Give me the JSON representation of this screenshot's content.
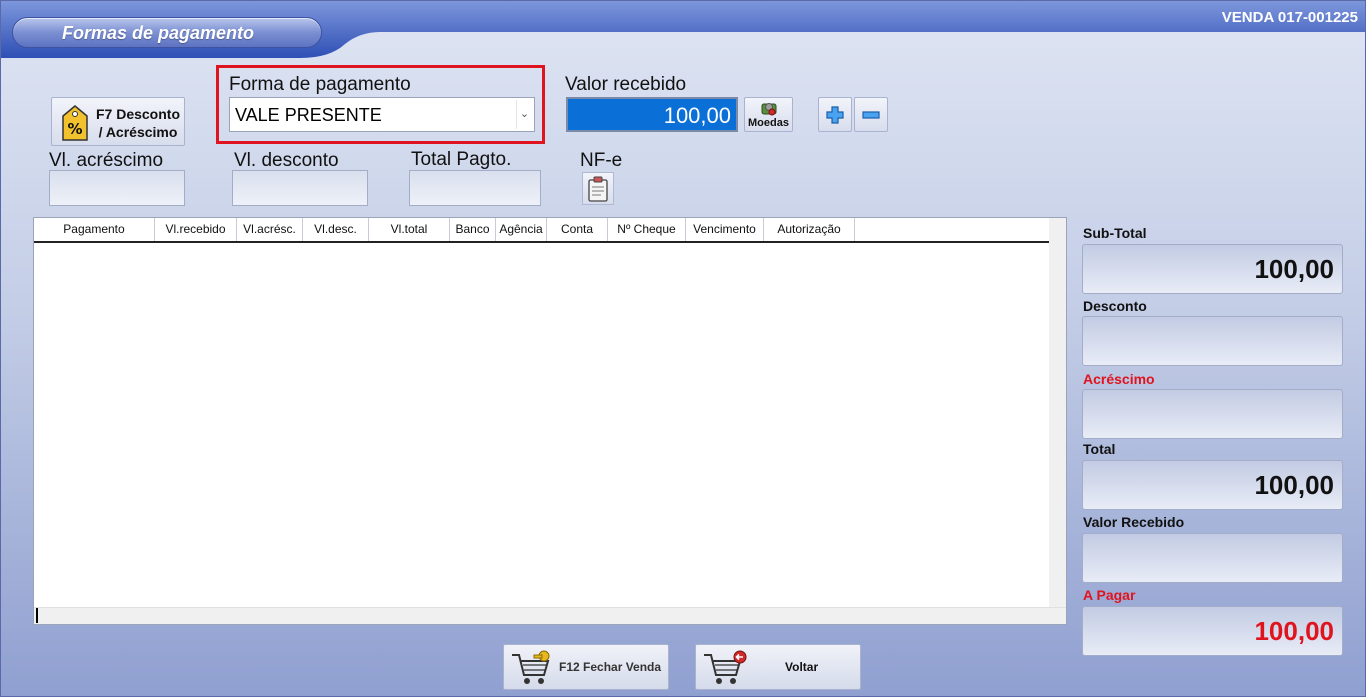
{
  "window": {
    "title": "Formas de pagamento",
    "venda_code": "VENDA 017-001225"
  },
  "toolbar": {
    "f7_label_line1": "F7 Desconto",
    "f7_label_line2": "/ Acréscimo"
  },
  "payment_form": {
    "label": "Forma de pagamento",
    "selected": "VALE PRESENTE"
  },
  "valor_recebido": {
    "label": "Valor recebido",
    "value": "100,00",
    "moedas_label": "Moedas"
  },
  "fields": {
    "acrescimo_label": "Vl. acréscimo",
    "desconto_label": "Vl. desconto",
    "total_pagto_label": "Total Pagto.",
    "nfe_label": "NF-e"
  },
  "grid": {
    "columns": [
      "Pagamento",
      "Vl.recebido",
      "Vl.acrésc.",
      "Vl.desc.",
      "Vl.total",
      "Banco",
      "Agência",
      "Conta",
      "Nº Cheque",
      "Vencimento",
      "Autorização"
    ],
    "rows": []
  },
  "summary": {
    "subtotal_label": "Sub-Total",
    "subtotal_value": "100,00",
    "desconto_label": "Desconto",
    "desconto_value": "",
    "acrescimo_label": "Acréscimo",
    "acrescimo_value": "",
    "total_label": "Total",
    "total_value": "100,00",
    "valor_recebido_label": "Valor Recebido",
    "valor_recebido_value": "",
    "a_pagar_label": "A Pagar",
    "a_pagar_value": "100,00"
  },
  "footer": {
    "fechar_label": "F12 Fechar Venda",
    "voltar_label": "Voltar"
  },
  "colors": {
    "accent_red": "#e0141e",
    "selected_blue": "#0a6fd6",
    "header_blue": "#3f5fc0"
  }
}
